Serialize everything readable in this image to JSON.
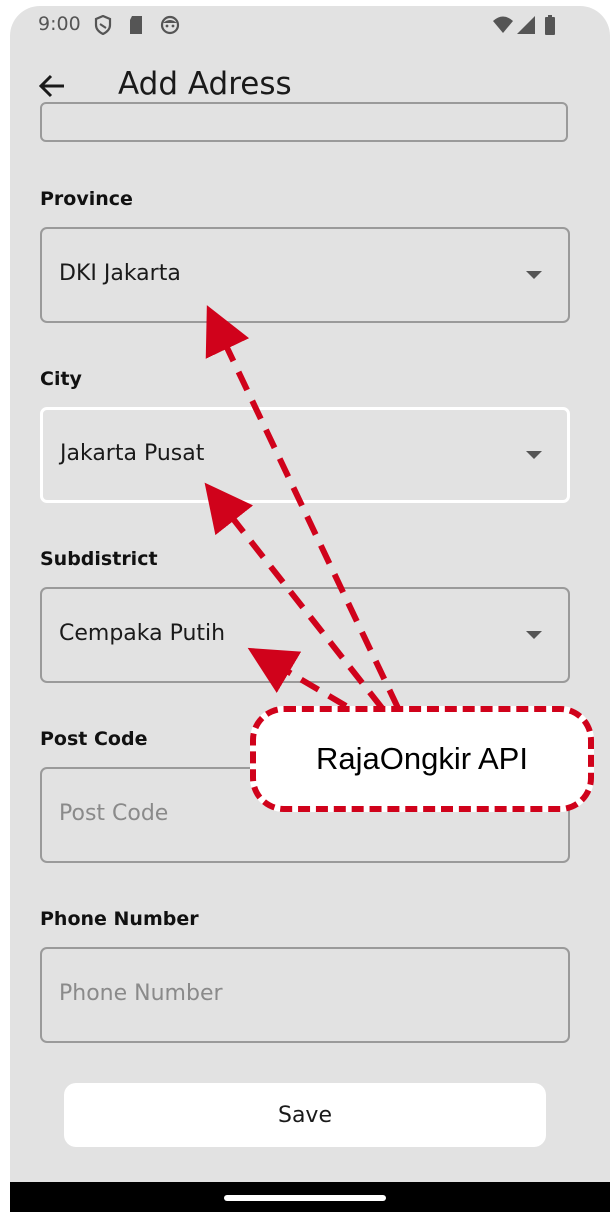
{
  "status_bar": {
    "time": "9:00",
    "left_icons": [
      "shield-icon",
      "sd-card-icon",
      "face-icon"
    ],
    "right_icons": [
      "wifi-icon",
      "signal-icon",
      "battery-icon"
    ]
  },
  "app_bar": {
    "back_icon": "back-arrow-icon",
    "title": "Add Adress"
  },
  "form": {
    "province": {
      "label": "Province",
      "value": "DKI Jakarta"
    },
    "city": {
      "label": "City",
      "value": "Jakarta Pusat"
    },
    "subdistrict": {
      "label": "Subdistrict",
      "value": "Cempaka Putih"
    },
    "post_code": {
      "label": "Post Code",
      "placeholder": "Post Code"
    },
    "phone_number": {
      "label": "Phone Number",
      "placeholder": "Phone Number"
    },
    "save_label": "Save"
  },
  "annotation": {
    "callout_text": "RajaOngkir API",
    "color": "#d0021b"
  },
  "colors": {
    "background": "#e2e2e2",
    "card": "#ffffff",
    "field_border": "#9a9a9a"
  }
}
